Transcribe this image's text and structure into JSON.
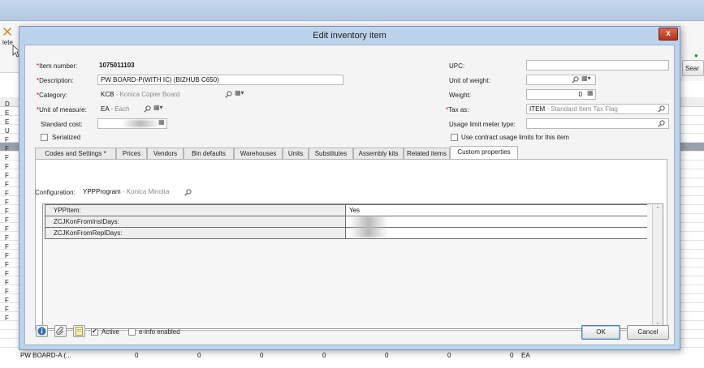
{
  "background": {
    "toolbar": {
      "delete_label": "lete",
      "search_label": "Sear"
    },
    "last_row": {
      "description": "PW BOARD-A (...",
      "values": [
        "0",
        "0",
        "0",
        "0",
        "0",
        "0",
        "0"
      ],
      "uom": "EA"
    },
    "row_letters": [
      "D",
      "E",
      "E",
      "U",
      "F",
      "F",
      "F",
      "F",
      "F",
      "F",
      "F",
      "F",
      "F",
      "F",
      "F",
      "F",
      "F",
      "F",
      "F",
      "F",
      "F",
      "F",
      "F",
      "F",
      "F"
    ]
  },
  "dialog": {
    "title": "Edit inventory item",
    "close_label": "x",
    "left_form": {
      "item_number_label": "Item number:",
      "item_number_value": "1075011103",
      "description_label": "Description:",
      "description_value": "PW BOARD-P(WITH IC) (BIZHUB C650)",
      "category_label": "Category:",
      "category_code": "KCB",
      "category_name": " - Konica Copier Board",
      "uom_label": "Unit of measure:",
      "uom_code": "EA",
      "uom_name": " - Each",
      "standard_cost_label": "Standard cost:",
      "serialized_label": "Serialized"
    },
    "right_form": {
      "upc_label": "UPC:",
      "upc_value": "",
      "unit_weight_label": "Unit of weight:",
      "weight_label": "Weight:",
      "weight_value": "0",
      "tax_as_label": "Tax as:",
      "tax_code": "ITEM",
      "tax_name": " - Standard Item Tax Flag",
      "usage_limit_label": "Usage limit meter type:",
      "contract_usage_label": "Use contract usage limits for this item"
    },
    "tabs": [
      "Codes and Settings *",
      "Prices",
      "Vendors",
      "Bin defaults",
      "Warehouses",
      "Units",
      "Substitutes",
      "Assembly kits",
      "Related items",
      "Custom properties"
    ],
    "custom_props": {
      "configuration_label": "Configuration:",
      "configuration_code": "YPPProgram",
      "configuration_name": " - Konica Minolta",
      "rows": [
        {
          "name": "YPPItem:",
          "value": "Yes"
        },
        {
          "name": "ZCJKonFromInstDays:",
          "value": ""
        },
        {
          "name": "ZCJKonFromReplDays:",
          "value": ""
        }
      ]
    },
    "footer": {
      "active_label": "Active",
      "active_checked": true,
      "einfo_label": "e-info enabled",
      "einfo_checked": false,
      "ok_label": "OK",
      "cancel_label": "Cancel"
    }
  },
  "colors": {
    "required_marker": "#d40000",
    "dialog_frame": "#bcd3ec",
    "close_button": "#c4412a"
  }
}
